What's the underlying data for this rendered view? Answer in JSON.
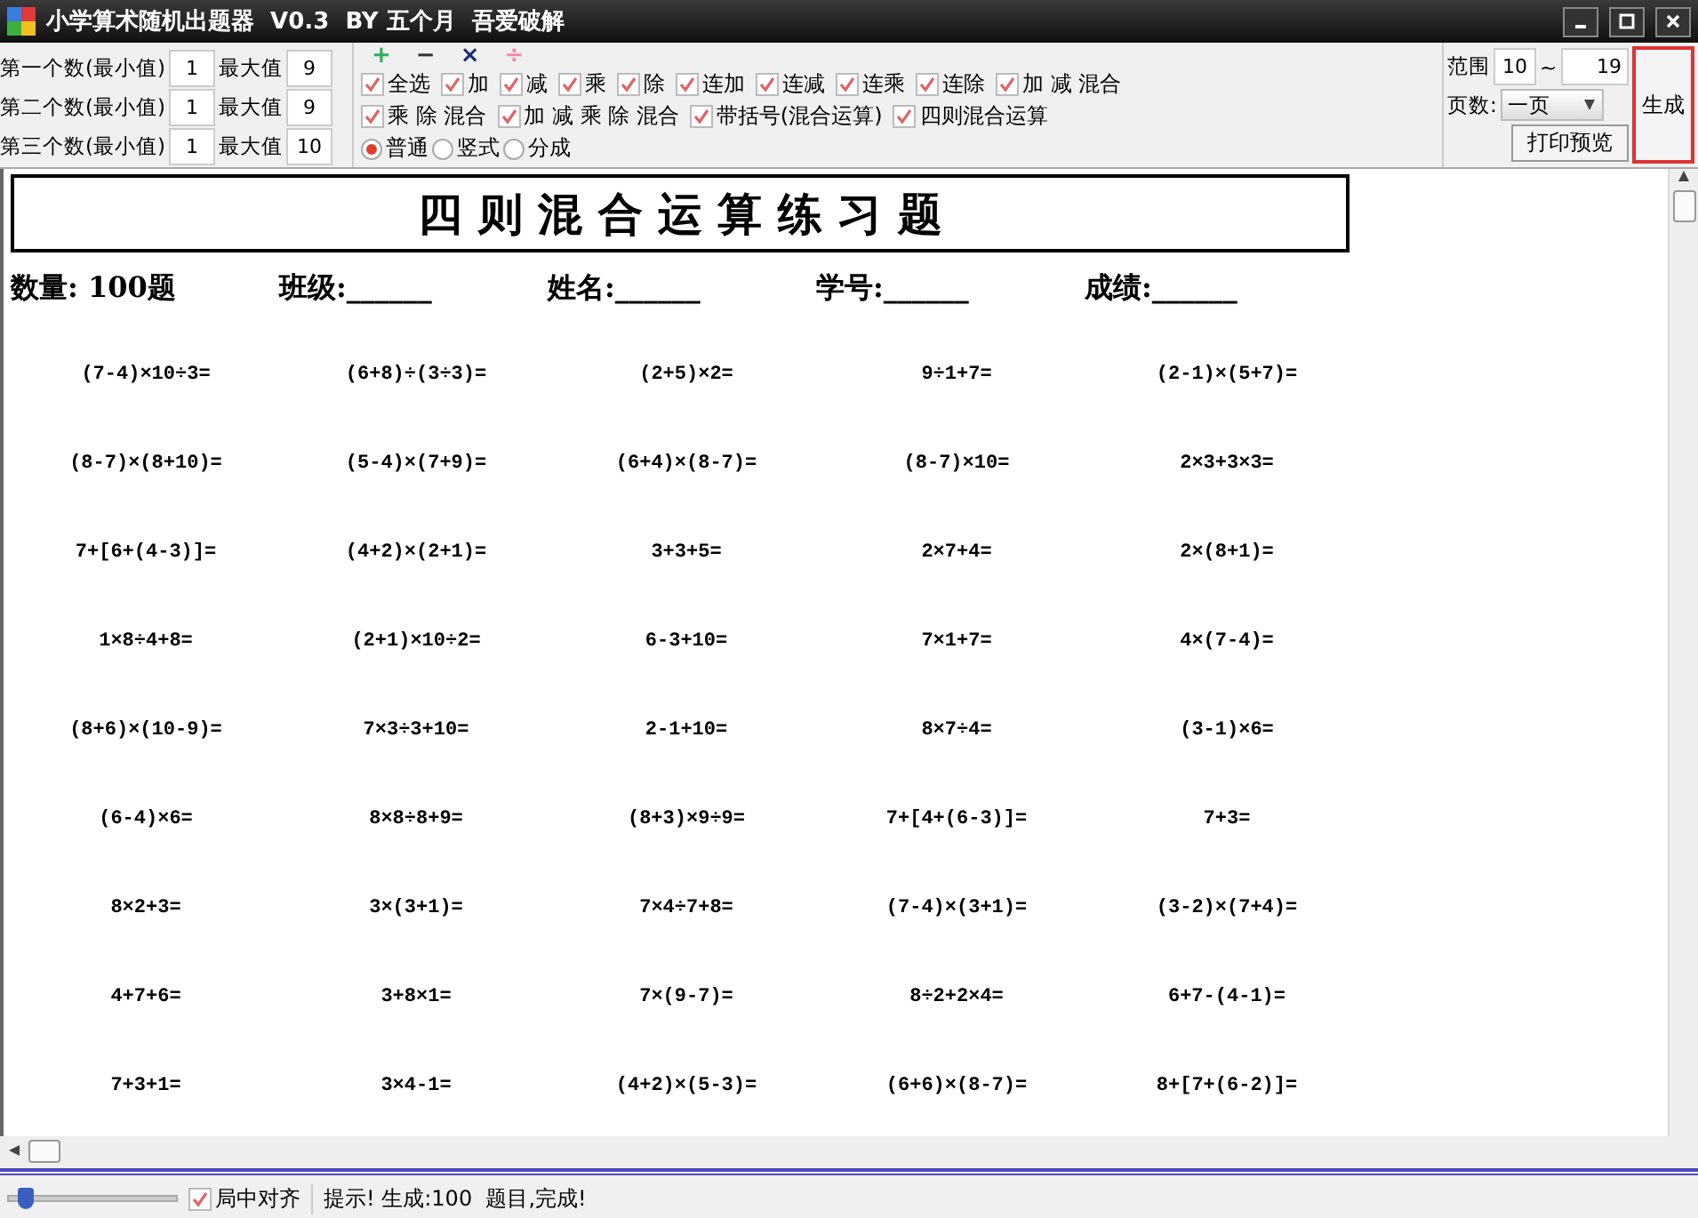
{
  "window": {
    "title": "小学算术随机出题器  V0.3  BY 五个月  吾爱破解"
  },
  "number_ranges": [
    {
      "label": "第一个数(最小值)",
      "min": "1",
      "max_label": "最大值",
      "max": "9"
    },
    {
      "label": "第二个数(最小值)",
      "min": "1",
      "max_label": "最大值",
      "max": "9"
    },
    {
      "label": "第三个数(最小值)",
      "min": "1",
      "max_label": "最大值",
      "max": "10"
    }
  ],
  "operators": [
    {
      "symbol": "+",
      "color": "#2fae5a"
    },
    {
      "symbol": "−",
      "color": "#333333"
    },
    {
      "symbol": "×",
      "color": "#1c2a78"
    },
    {
      "symbol": "÷",
      "color": "#f08aa8"
    }
  ],
  "options_row_1": [
    {
      "label": "全选",
      "checked": true
    },
    {
      "label": "加",
      "checked": true
    },
    {
      "label": "减",
      "checked": true
    },
    {
      "label": "乘",
      "checked": true
    },
    {
      "label": "除",
      "checked": true
    },
    {
      "label": "连加",
      "checked": true
    },
    {
      "label": "连减",
      "checked": true
    },
    {
      "label": "连乘",
      "checked": true
    },
    {
      "label": "连除",
      "checked": true
    },
    {
      "label": "加 减 混合",
      "checked": true
    }
  ],
  "options_row_2": [
    {
      "label": "乘 除 混合",
      "checked": true
    },
    {
      "label": "加 减 乘 除 混合",
      "checked": true
    },
    {
      "label": "带括号(混合运算)",
      "checked": true
    },
    {
      "label": "四则混合运算",
      "checked": true
    }
  ],
  "format": [
    {
      "label": "普通",
      "selected": true
    },
    {
      "label": "竖式",
      "selected": false
    },
    {
      "label": "分成",
      "selected": false
    }
  ],
  "range": {
    "label": "范围",
    "from": "10",
    "separator": "~",
    "to": "19"
  },
  "pages": {
    "label": "页数:",
    "value": "一页"
  },
  "print_preview_button": "打印预览",
  "generate_button": "生成",
  "sheet": {
    "title": "四 则 混 合 运 算 练 习 题",
    "info": [
      "数量: 100题",
      "班级:______",
      "姓名:______",
      "学号:______",
      "成绩:______"
    ],
    "problems": [
      [
        "(7-4)×10÷3=",
        "(6+8)÷(3÷3)=",
        "(2+5)×2=",
        "9÷1+7=",
        "(2-1)×(5+7)="
      ],
      [
        "(8-7)×(8+10)=",
        "(5-4)×(7+9)=",
        "(6+4)×(8-7)=",
        "(8-7)×10=",
        "2×3+3×3="
      ],
      [
        "7+[6+(4-3)]=",
        "(4+2)×(2+1)=",
        "3+3+5=",
        "2×7+4=",
        "2×(8+1)="
      ],
      [
        "1×8÷4+8=",
        "(2+1)×10÷2=",
        "6-3+10=",
        "7×1+7=",
        "4×(7-4)="
      ],
      [
        "(8+6)×(10-9)=",
        "7×3÷3+10=",
        "2-1+10=",
        "8×7÷4=",
        "(3-1)×6="
      ],
      [
        "(6-4)×6=",
        "8×8÷8+9=",
        "(8+3)×9÷9=",
        "7+[4+(6-3)]=",
        "7+3="
      ],
      [
        "8×2+3=",
        "3×(3+1)=",
        "7×4÷7+8=",
        "(7-4)×(3+1)=",
        "(3-2)×(7+4)="
      ],
      [
        "4+7+6=",
        "3+8×1=",
        "7×(9-7)=",
        "8÷2+2×4=",
        "6+7-(4-1)="
      ],
      [
        "7+3+1=",
        "3×4-1=",
        "(4+2)×(5-3)=",
        "(6+6)×(8-7)=",
        "8+[7+(6-2)]="
      ]
    ]
  },
  "status_bar": {
    "zoom": {
      "level": 0.1
    },
    "center_align": {
      "label": "局中对齐",
      "checked": true
    },
    "message": "提示! 生成:100  题目,完成!"
  }
}
